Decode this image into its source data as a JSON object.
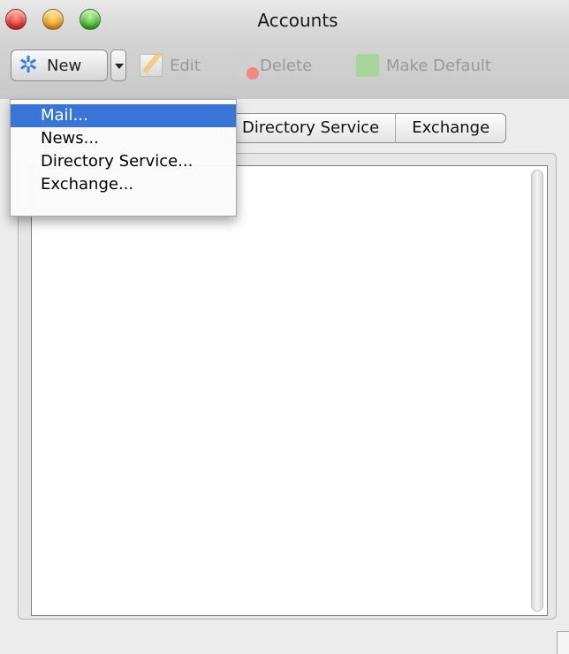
{
  "window": {
    "title": "Accounts"
  },
  "toolbar": {
    "new_label": "New",
    "edit_label": "Edit",
    "delete_label": "Delete",
    "make_default_label": "Make Default"
  },
  "tabs": [
    {
      "label": "Directory Service"
    },
    {
      "label": "Exchange"
    }
  ],
  "new_menu": {
    "items": [
      {
        "label": "Mail...",
        "selected": true
      },
      {
        "label": "News..."
      },
      {
        "label": "Directory Service..."
      },
      {
        "label": "Exchange..."
      }
    ]
  },
  "colors": {
    "menu_highlight": "#3875d7",
    "new_icon": "#3a7de0"
  },
  "icons": {
    "new": "star-icon",
    "edit": "edit-pencil-icon",
    "delete": "trash-icon",
    "make_default": "make-default-icon"
  }
}
